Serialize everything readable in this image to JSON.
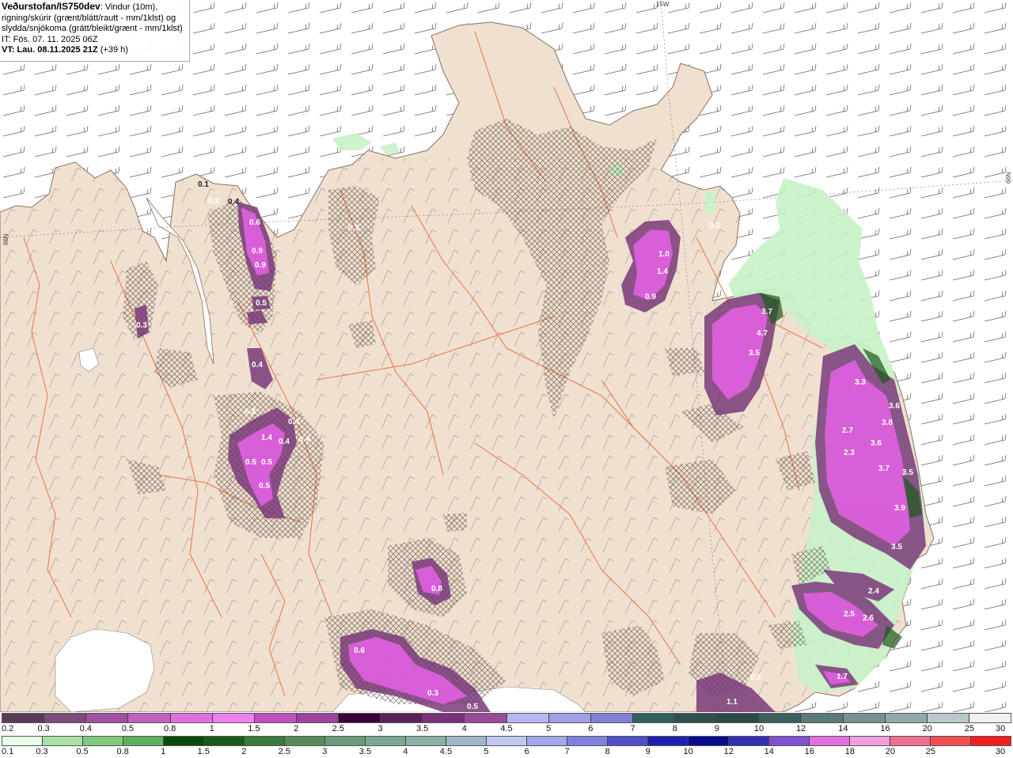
{
  "header": {
    "title": "Veðurstofan/IS750dev",
    "desc_1": ": Vindur (10m),",
    "desc_2": "rigning/skúrir (grænt/blátt/rautt - mm/1klst) og",
    "desc_3": "slydda/snjókoma (grátt/bleikt/grænt - mm/1klst)",
    "it": "IT: Fös. 07. 11. 2025 06Z",
    "vt": "VT: Lau. 08.11.2025 21Z",
    "vt_lead": "(+39 h)"
  },
  "grid_labels": {
    "lon_top": "15W",
    "lat_left": "66N",
    "lat_right": "66N"
  },
  "colors": {
    "land": "#f0e0d0",
    "sea": "#ffffff",
    "rivers": "#e8734a",
    "rain_green_light": "#c8f2c8",
    "snow_magenta": "#e060e0",
    "wind_barbs": "#555555"
  },
  "map_values": [
    {
      "text": "0.1"
    },
    {
      "text": "0.8"
    },
    {
      "text": "0.4"
    },
    {
      "text": "0.6"
    },
    {
      "text": "0.9"
    },
    {
      "text": "0.9"
    },
    {
      "text": "0.5"
    },
    {
      "text": "0.3"
    },
    {
      "text": "0.4"
    },
    {
      "text": "0.3"
    },
    {
      "text": "0.4"
    },
    {
      "text": "1.4"
    },
    {
      "text": "0.4"
    },
    {
      "text": "0.4"
    },
    {
      "text": "0.5"
    },
    {
      "text": "0.5"
    },
    {
      "text": "0.5"
    },
    {
      "text": "0.3"
    },
    {
      "text": "1.0"
    },
    {
      "text": "1.4"
    },
    {
      "text": "0.9"
    },
    {
      "text": "0.2"
    },
    {
      "text": "3.7"
    },
    {
      "text": "4.7"
    },
    {
      "text": "3.5"
    },
    {
      "text": "3.3"
    },
    {
      "text": "3.6"
    },
    {
      "text": "3.8"
    },
    {
      "text": "2.7"
    },
    {
      "text": "3.6"
    },
    {
      "text": "2.3"
    },
    {
      "text": "3.7"
    },
    {
      "text": "3.5"
    },
    {
      "text": "3.9"
    },
    {
      "text": "3.5"
    },
    {
      "text": "2.4"
    },
    {
      "text": "2.5"
    },
    {
      "text": "2.6"
    },
    {
      "text": "1.7"
    },
    {
      "text": "0.8"
    },
    {
      "text": "0.6"
    },
    {
      "text": "0.3"
    },
    {
      "text": "0.5"
    },
    {
      "text": "0.2"
    },
    {
      "text": "1.1"
    }
  ],
  "legend_snow": {
    "colors": [
      "#5a3a5a",
      "#7a4a7a",
      "#a050a0",
      "#c060c0",
      "#e070e0",
      "#f080f0",
      "#c050c0",
      "#a040a0",
      "#3a003a",
      "#5a205a",
      "#7a307a",
      "#9a4a9a",
      "#b8b8f0",
      "#a0a0e8",
      "#8080d8",
      "#306060",
      "#305050",
      "#2a4a4a",
      "#3a6060",
      "#5a7a7a",
      "#7a9090",
      "#90a8a8",
      "#b8c8c8",
      "#f0f0f0"
    ],
    "ticks": [
      "0.2",
      "0.3",
      "0.4",
      "0.5",
      "0.8",
      "1",
      "1.5",
      "2",
      "2.5",
      "3",
      "3.5",
      "4",
      "4.5",
      "5",
      "6",
      "7",
      "8",
      "9",
      "10",
      "12",
      "14",
      "16",
      "20",
      "25",
      "30"
    ]
  },
  "legend_rain": {
    "colors": [
      "#e8ffe8",
      "#a8e0a8",
      "#80c880",
      "#60b060",
      "#0a4a0a",
      "#1a5a1a",
      "#3a7a3a",
      "#5a8a5a",
      "#6a9a7a",
      "#7aa890",
      "#8ab0a8",
      "#a0b8c8",
      "#c0c8f0",
      "#a0a8e8",
      "#8080e0",
      "#5050c8",
      "#2020b0",
      "#0a0a90",
      "#3030b0",
      "#8050d0",
      "#e070e0",
      "#f0a0e0",
      "#f07090",
      "#f05050",
      "#f02020"
    ],
    "ticks": [
      "0.1",
      "0.3",
      "0.5",
      "0.8",
      "1",
      "1.5",
      "2",
      "2.5",
      "3",
      "3.5",
      "4",
      "4.5",
      "5",
      "6",
      "7",
      "8",
      "9",
      "10",
      "12",
      "14",
      "16",
      "18",
      "20",
      "25",
      "30"
    ]
  }
}
